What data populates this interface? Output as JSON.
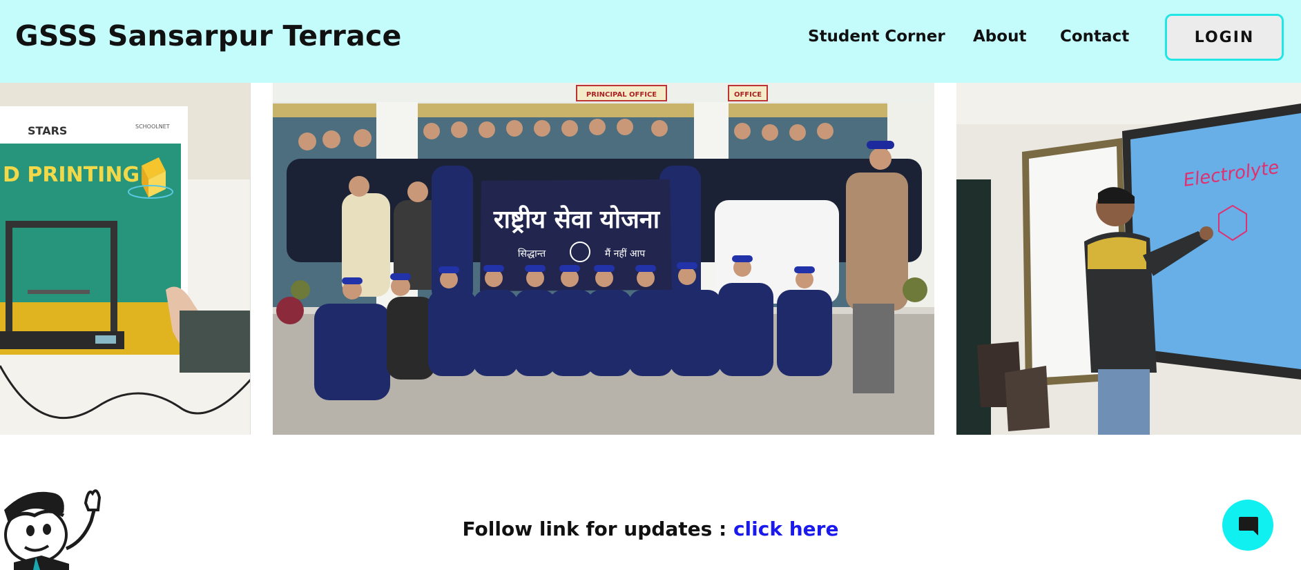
{
  "header": {
    "brand": "GSSS Sansarpur Terrace",
    "nav": [
      "Student Corner",
      "About",
      "Contact"
    ],
    "login_label": "LOGIN"
  },
  "carousel": {
    "slides": [
      {
        "poster_brand": "STARS",
        "poster_brand_right": "SCHOOLNET",
        "poster_title": "D PRINTING"
      },
      {
        "banner_text": "राष्ट्रीय सेवा योजना",
        "banner_sub_left": "सिद्धान्त",
        "banner_sub_right": "मैं नहीं आप",
        "sign_left": "PRINCIPAL OFFICE",
        "sign_right": "OFFICE"
      },
      {
        "board_text": "Electrolyte"
      }
    ]
  },
  "footer": {
    "follow_text": "Follow link for updates : ",
    "link_text": "click here"
  },
  "colors": {
    "header_bg": "#c4fcfc",
    "login_border": "#22e6e6",
    "link": "#1a1aee",
    "chat_button": "#10f0f0"
  },
  "icons": [
    "chat-bubble-icon",
    "mascot-illustration"
  ]
}
